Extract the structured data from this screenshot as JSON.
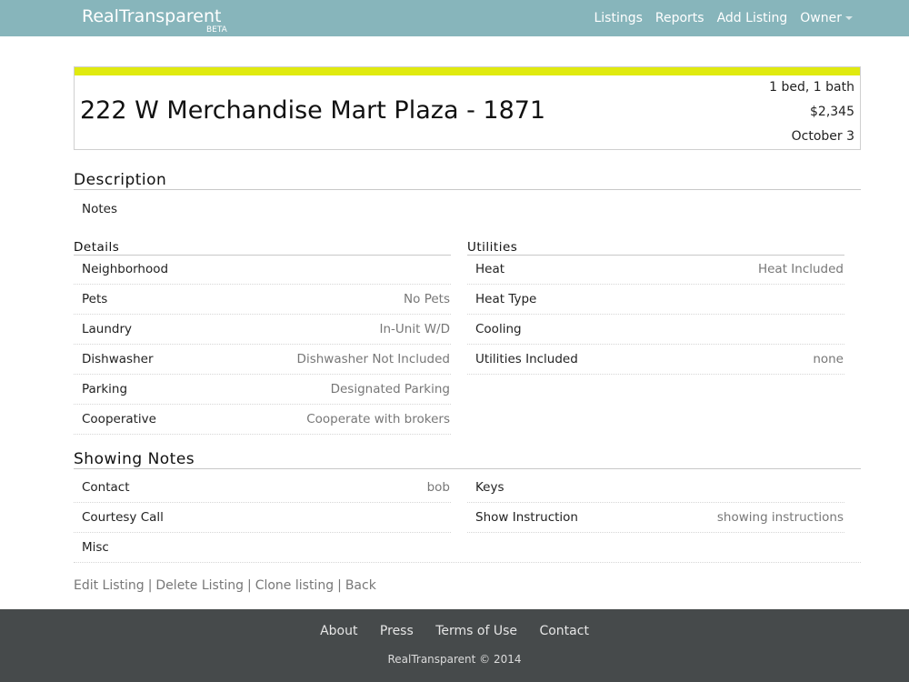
{
  "nav": {
    "brand": "RealTransparent",
    "beta": "BETA",
    "items": [
      "Listings",
      "Reports",
      "Add Listing",
      "Owner"
    ]
  },
  "listing": {
    "title": "222 W Merchandise Mart Plaza - 1871",
    "beds_baths": "1 bed, 1 bath",
    "price": "$2,345",
    "date": "October 3",
    "stripe_color": "#e0ea0f"
  },
  "description": {
    "title": "Description",
    "notes": "Notes"
  },
  "details": {
    "title": "Details",
    "rows": [
      {
        "label": "Neighborhood",
        "value": ""
      },
      {
        "label": "Pets",
        "value": "No Pets"
      },
      {
        "label": "Laundry",
        "value": "In-Unit W/D"
      },
      {
        "label": "Dishwasher",
        "value": "Dishwasher Not Included"
      },
      {
        "label": "Parking",
        "value": "Designated Parking"
      },
      {
        "label": "Cooperative",
        "value": "Cooperate with brokers"
      }
    ]
  },
  "utilities": {
    "title": "Utilities",
    "rows": [
      {
        "label": "Heat",
        "value": "Heat Included"
      },
      {
        "label": "Heat Type",
        "value": ""
      },
      {
        "label": "Cooling",
        "value": ""
      },
      {
        "label": "Utilities Included",
        "value": "none"
      }
    ]
  },
  "showing": {
    "title": "Showing Notes",
    "left_rows": [
      {
        "label": "Contact",
        "value": "bob"
      },
      {
        "label": "Courtesy Call",
        "value": ""
      },
      {
        "label": "Misc",
        "value": ""
      }
    ],
    "right_rows": [
      {
        "label": "Keys",
        "value": ""
      },
      {
        "label": "Show Instruction",
        "value": "showing instructions"
      }
    ]
  },
  "actions": {
    "edit": "Edit Listing",
    "delete": "Delete Listing",
    "clone": "Clone listing",
    "back": "Back",
    "separator": "|"
  },
  "footer": {
    "links": [
      "About",
      "Press",
      "Terms of Use",
      "Contact"
    ],
    "copyright": "RealTransparent © 2014"
  },
  "colors": {
    "topbar": "#87b5bb",
    "footer": "#464a4b",
    "accent": "#e0ea0f"
  }
}
